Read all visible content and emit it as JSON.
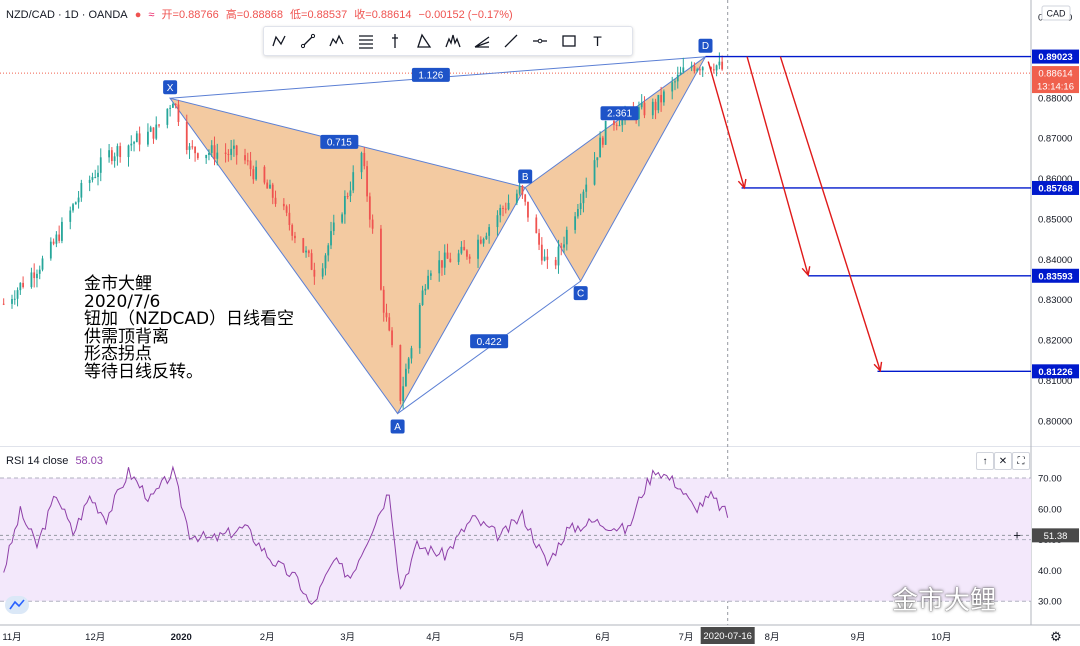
{
  "header": {
    "symbol": "NZD/CAD · 1D · OANDA",
    "open": "开=0.88766",
    "high": "高=0.88868",
    "low": "低=0.88537",
    "close": "收=0.88614",
    "change": "−0.00152 (−0.17%)"
  },
  "toolbar": {
    "text_tool": "T"
  },
  "currency": "CAD",
  "price_axis": {
    "min": 0.795,
    "max": 0.9035,
    "ticks": [
      0.9,
      0.89,
      0.88,
      0.87,
      0.86,
      0.85,
      0.84,
      0.83,
      0.82,
      0.81,
      0.8
    ],
    "tick_labels": [
      "0.90000",
      "0.89000",
      "0.88000",
      "0.87000",
      "0.86000",
      "0.85000",
      "0.84000",
      "0.83000",
      "0.82000",
      "0.81000",
      "0.80000"
    ],
    "last_price": 0.88614,
    "last_price_label": "0.88614",
    "countdown": "13:14:16"
  },
  "time_axis": {
    "labels": [
      "11月",
      "12月",
      "2020",
      "2月",
      "3月",
      "4月",
      "5月",
      "6月",
      "7月",
      "8月",
      "9月",
      "10月"
    ],
    "label_days": [
      0,
      30,
      61,
      92,
      121,
      152,
      182,
      213,
      243,
      274,
      305,
      335
    ],
    "cursor_date": "2020-07-16",
    "cursor_day": 258
  },
  "chart_data": [
    {
      "type": "candlestick",
      "title": "NZD/CAD · 1D · OANDA",
      "x_unit": "days since 11月 label",
      "trend_anchors": [
        {
          "day": -3,
          "price": 0.829
        },
        {
          "day": 13,
          "price": 0.841
        },
        {
          "day": 25,
          "price": 0.857
        },
        {
          "day": 35,
          "price": 0.866
        },
        {
          "day": 52,
          "price": 0.872
        },
        {
          "day": 58,
          "price": 0.88
        },
        {
          "day": 64,
          "price": 0.867
        },
        {
          "day": 82,
          "price": 0.866
        },
        {
          "day": 96,
          "price": 0.854
        },
        {
          "day": 110,
          "price": 0.836
        },
        {
          "day": 126,
          "price": 0.866
        },
        {
          "day": 133,
          "price": 0.832
        },
        {
          "day": 140,
          "price": 0.806
        },
        {
          "day": 150,
          "price": 0.838
        },
        {
          "day": 165,
          "price": 0.842
        },
        {
          "day": 176,
          "price": 0.852
        },
        {
          "day": 183,
          "price": 0.857
        },
        {
          "day": 194,
          "price": 0.836
        },
        {
          "day": 205,
          "price": 0.856
        },
        {
          "day": 215,
          "price": 0.874
        },
        {
          "day": 232,
          "price": 0.878
        },
        {
          "day": 244,
          "price": 0.888
        },
        {
          "day": 253,
          "price": 0.8885
        },
        {
          "day": 258,
          "price": 0.8861
        }
      ],
      "harmonic_pattern": {
        "points": [
          {
            "label": "X",
            "day": 57,
            "price": 0.8799
          },
          {
            "label": "A",
            "day": 139,
            "price": 0.8018
          },
          {
            "label": "B",
            "day": 185,
            "price": 0.8578
          },
          {
            "label": "C",
            "day": 205,
            "price": 0.8346
          },
          {
            "label": "D",
            "day": 250,
            "price": 0.8902
          }
        ],
        "ratios": [
          {
            "label": "1.126",
            "day": 151,
            "price": 0.8857
          },
          {
            "label": "0.715",
            "day": 118,
            "price": 0.8691
          },
          {
            "label": "0.422",
            "day": 172,
            "price": 0.8197
          },
          {
            "label": "2.361",
            "day": 219,
            "price": 0.8762
          }
        ]
      },
      "target_levels": [
        {
          "price": 0.89023,
          "label": "0.89023",
          "from_day": 250
        },
        {
          "price": 0.85768,
          "label": "0.85768",
          "from_day": 263
        },
        {
          "price": 0.83593,
          "label": "0.83593",
          "from_day": 287
        },
        {
          "price": 0.81226,
          "label": "0.81226",
          "from_day": 312
        }
      ],
      "arrows": [
        {
          "from_day": 251,
          "from_price": 0.889,
          "to_day": 264,
          "to_price": 0.8577
        },
        {
          "from_day": 265,
          "from_price": 0.8902,
          "to_day": 287,
          "to_price": 0.8361
        },
        {
          "from_day": 277,
          "from_price": 0.8902,
          "to_day": 313,
          "to_price": 0.8124
        }
      ]
    },
    {
      "type": "line",
      "title": "RSI 14 close",
      "value_label": "58.03",
      "y_ticks": [
        70,
        60,
        50,
        40,
        30
      ],
      "y_tick_labels": [
        "70.00",
        "60.00",
        "50.00",
        "40.00",
        "30.00"
      ],
      "ylim": [
        25,
        73.5
      ],
      "band": [
        30,
        70
      ],
      "midline": 50,
      "cursor_value_label": "51.38",
      "anchors": [
        {
          "day": -3,
          "value": 40
        },
        {
          "day": 3,
          "value": 59
        },
        {
          "day": 9,
          "value": 48
        },
        {
          "day": 16,
          "value": 65
        },
        {
          "day": 22,
          "value": 52
        },
        {
          "day": 28,
          "value": 64
        },
        {
          "day": 34,
          "value": 57
        },
        {
          "day": 42,
          "value": 72
        },
        {
          "day": 50,
          "value": 63
        },
        {
          "day": 58,
          "value": 72
        },
        {
          "day": 64,
          "value": 52
        },
        {
          "day": 72,
          "value": 50
        },
        {
          "day": 84,
          "value": 54
        },
        {
          "day": 94,
          "value": 43
        },
        {
          "day": 103,
          "value": 37
        },
        {
          "day": 108,
          "value": 28
        },
        {
          "day": 116,
          "value": 43
        },
        {
          "day": 122,
          "value": 38
        },
        {
          "day": 131,
          "value": 56
        },
        {
          "day": 136,
          "value": 66
        },
        {
          "day": 140,
          "value": 34
        },
        {
          "day": 146,
          "value": 48
        },
        {
          "day": 156,
          "value": 45
        },
        {
          "day": 166,
          "value": 57
        },
        {
          "day": 176,
          "value": 51
        },
        {
          "day": 184,
          "value": 58
        },
        {
          "day": 193,
          "value": 42
        },
        {
          "day": 200,
          "value": 53
        },
        {
          "day": 210,
          "value": 56
        },
        {
          "day": 222,
          "value": 53
        },
        {
          "day": 227,
          "value": 65
        },
        {
          "day": 232,
          "value": 73
        },
        {
          "day": 240,
          "value": 68
        },
        {
          "day": 246,
          "value": 60
        },
        {
          "day": 252,
          "value": 64
        },
        {
          "day": 258,
          "value": 58
        }
      ]
    }
  ],
  "annotation": {
    "line1": "金市大鲤",
    "line2": "2020/7/6",
    "line3": "钮加（NZDCAD）日线看空",
    "line4": "供需顶背离",
    "line5": "形态拐点",
    "line6": "等待日线反转。"
  },
  "watermark": "金市大鲤",
  "colors": {
    "up": "#26a69a",
    "down": "#ef5350",
    "pattern_fill": "#f1c191",
    "pattern_line": "#5b7fd4",
    "label_bg": "#1e53c8",
    "level": "#0019cc",
    "arrow": "#e01a1a",
    "rsi_line": "#8e3fa8",
    "rsi_band": "#f3e8fb",
    "last_price_bg": "#f0604d"
  }
}
